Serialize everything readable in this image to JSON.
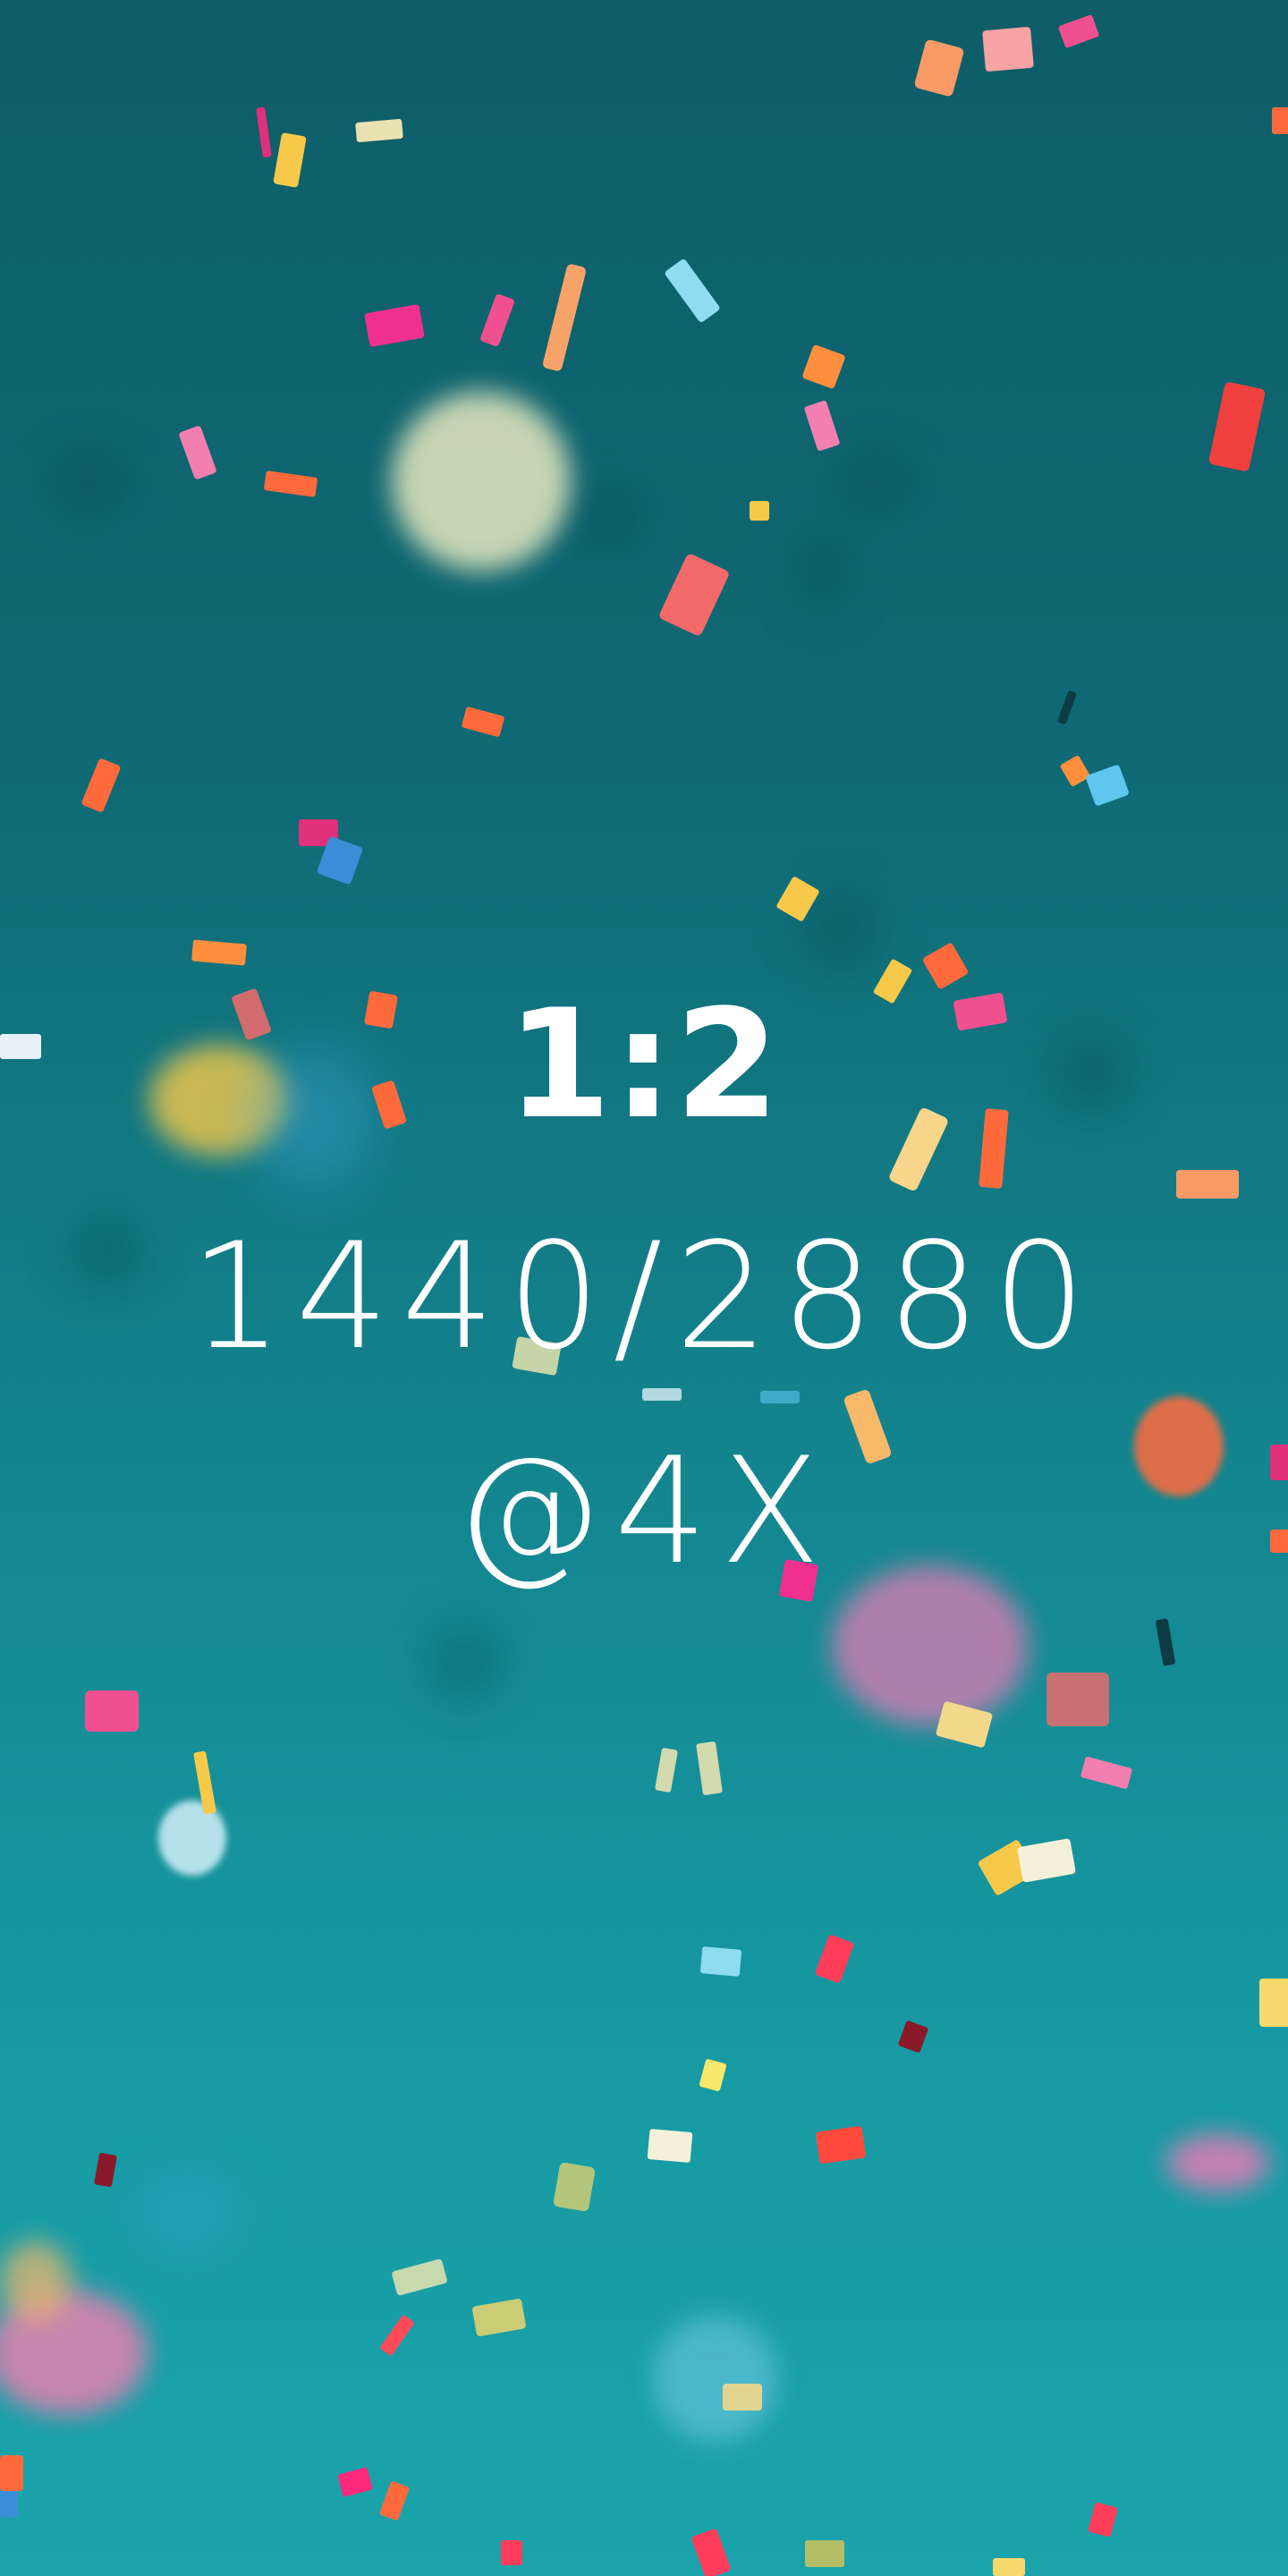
{
  "caption": {
    "ratio": "1:2",
    "dimensions": "1440/2880",
    "scale": "@4X"
  },
  "colors": {
    "background_top": "#0e5d68",
    "background_bottom": "#1aa3ab",
    "text": "#ffffff",
    "confetti": [
      "#f0508f",
      "#ff6a3d",
      "#f7c94a",
      "#e8e2b0",
      "#5fc6f0",
      "#e0307a",
      "#ff8f6b",
      "#f4f1d8"
    ]
  }
}
